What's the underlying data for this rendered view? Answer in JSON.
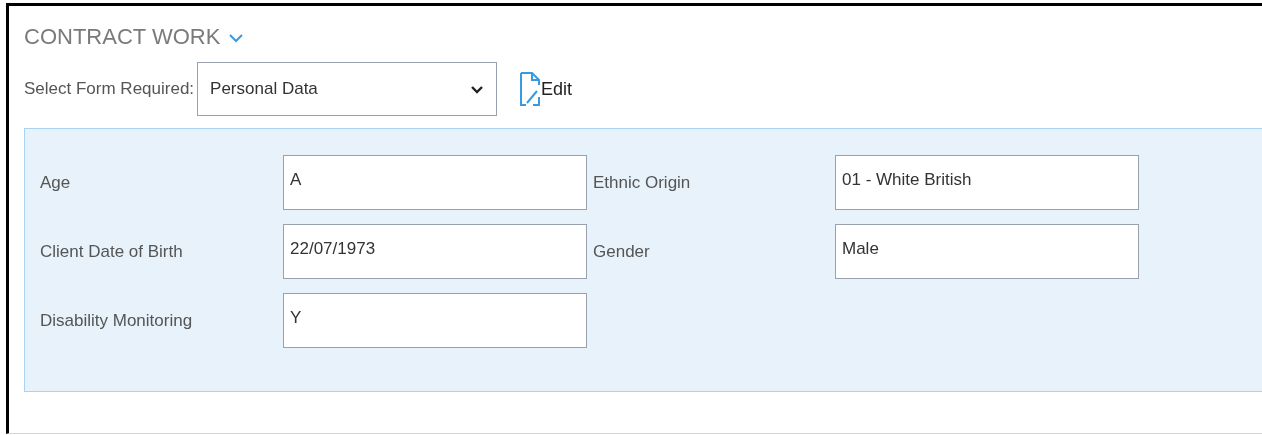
{
  "section": {
    "title": "CONTRACT WORK",
    "expanded": true
  },
  "form_select": {
    "label": "Select Form Required:",
    "value": "Personal Data"
  },
  "edit_button": {
    "label": "Edit"
  },
  "fields": [
    {
      "label": "Age",
      "value": "A"
    },
    {
      "label": "Ethnic Origin",
      "value": "01 - White British"
    },
    {
      "label": "Client Date of Birth",
      "value": "22/07/1973"
    },
    {
      "label": "Gender",
      "value": "Male"
    },
    {
      "label": "Disability Monitoring",
      "value": "Y"
    }
  ]
}
